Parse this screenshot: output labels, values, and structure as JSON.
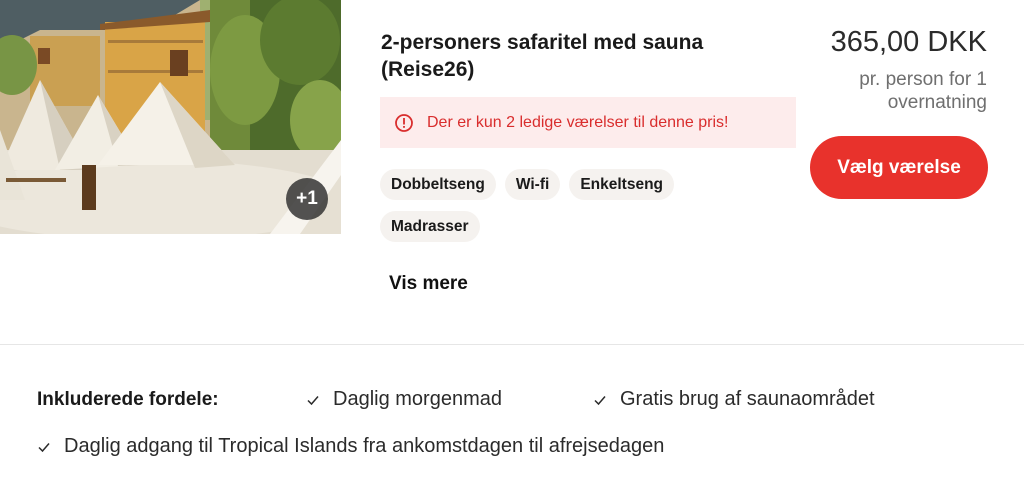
{
  "room": {
    "photo_alt": "Safari tents",
    "photo_count": "+1",
    "title_line1": "2-personers safaritel med sauna",
    "title_line2": "(Reise26)",
    "alert": {
      "icon": "alert-circle-icon",
      "text": "Der er kun 2 ledige værelser til denne pris!",
      "color": "#d92d2d",
      "background": "#fdecec"
    },
    "amenities": [
      "Dobbeltseng",
      "Wi-fi",
      "Enkeltseng",
      "Madrasser"
    ],
    "show_more": "Vis mere",
    "price": "365,00 DKK",
    "price_note": "pr. person for 1 overnatning",
    "select_button": "Vælg værelse",
    "accent_color": "#e8322c"
  },
  "benefits": {
    "label": "Inkluderede fordele:",
    "items": [
      "Daglig morgenmad",
      "Gratis brug af saunaområdet",
      "Daglig adgang til Tropical Islands fra ankomstdagen til afrejsedagen"
    ]
  }
}
